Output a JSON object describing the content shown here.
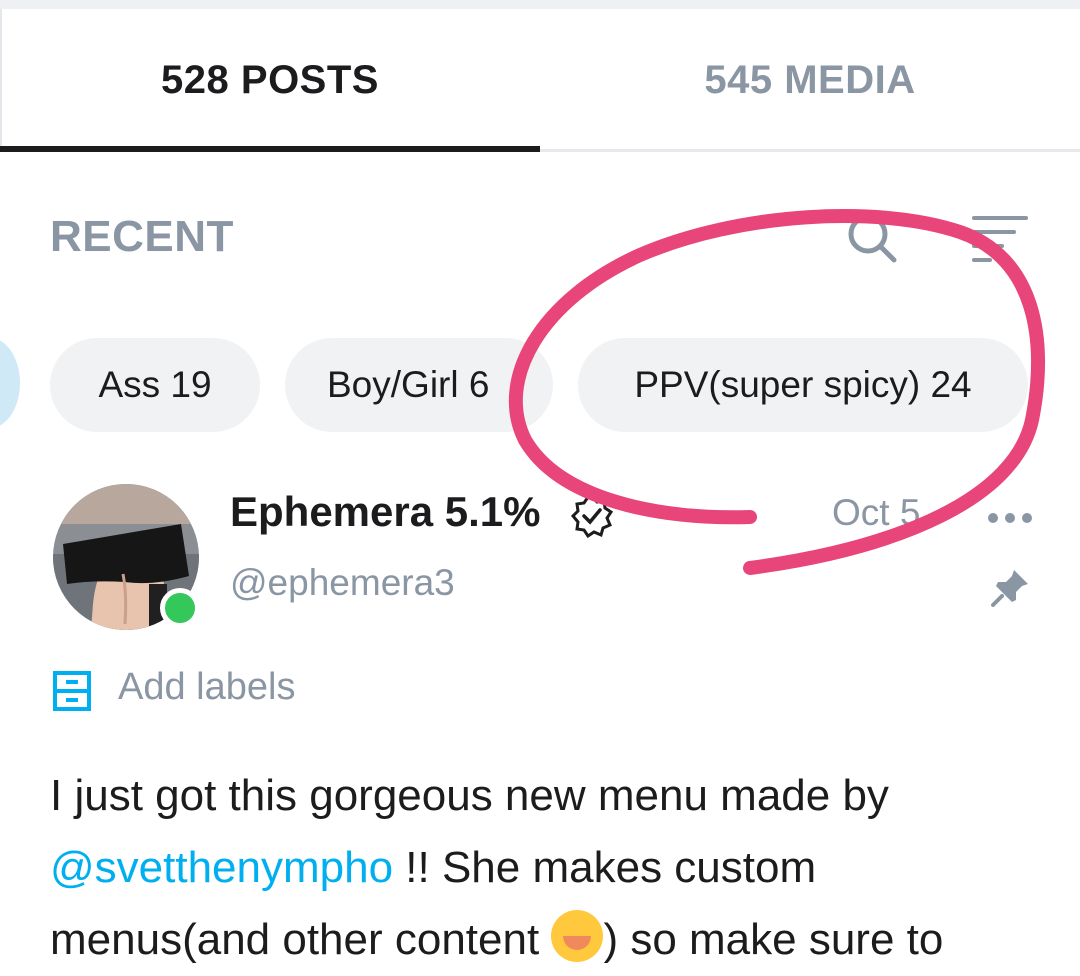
{
  "tabs": {
    "posts_label": "528 POSTS",
    "media_label": "545 MEDIA",
    "active": "posts"
  },
  "section": {
    "title": "RECENT"
  },
  "icons": {
    "search": "search-icon",
    "sort": "sort-icon",
    "more": "more-icon",
    "pin": "pin-icon",
    "labels": "label-icon",
    "verified": "verified-badge-icon"
  },
  "chips": [
    {
      "label": "Ass 19"
    },
    {
      "label": "Boy/Girl 6"
    },
    {
      "label": "PPV(super spicy) 24"
    }
  ],
  "post": {
    "author_name": "Ephemera 5.1%",
    "handle": "@ephemera3",
    "date": "Oct 5",
    "add_labels": "Add labels",
    "text": {
      "line1": "I just got this gorgeous new menu made by",
      "mention": "@svetthenympho",
      "line2_rest": " !! She makes custom",
      "line3_before": "menus(and other content ",
      "line3_after": ") so make sure to"
    },
    "online": true
  },
  "colors": {
    "accent": "#00aff0",
    "muted": "#8a96a3",
    "text": "#1c1c1e",
    "chip_bg": "#f1f2f4",
    "online": "#34c759",
    "annotation": "#e8457a"
  }
}
